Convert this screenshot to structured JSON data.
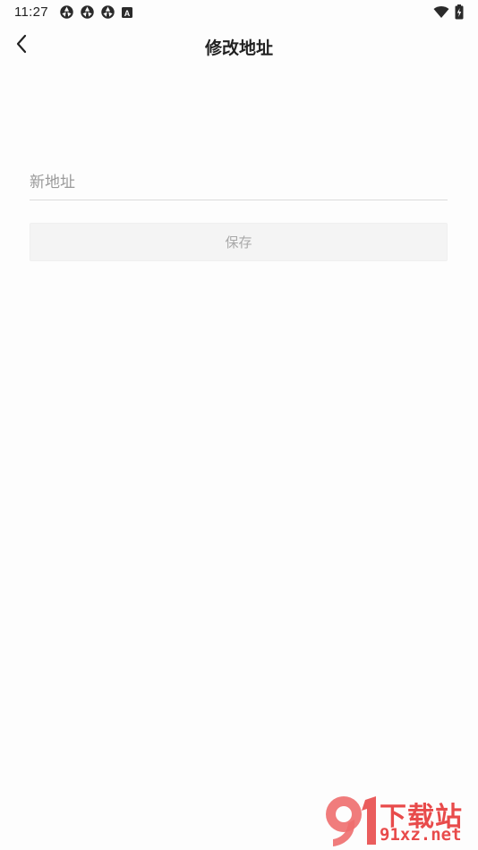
{
  "status_bar": {
    "time": "11:27",
    "notification_icons": [
      "aperture-icon",
      "aperture-icon",
      "aperture-icon",
      "a-box-icon"
    ],
    "a_box_letter": "A",
    "right_icons": [
      "wifi-icon",
      "battery-charging-icon"
    ]
  },
  "nav": {
    "back_icon": "chevron-left-icon",
    "title": "修改地址"
  },
  "form": {
    "address_value": "",
    "address_placeholder": "新地址",
    "save_label": "保存"
  },
  "watermark": {
    "logo_digits": "9",
    "top_text": "下载站",
    "bottom_text": "91xz.net"
  },
  "colors": {
    "background": "#fdfdfd",
    "title_text": "#222222",
    "placeholder_text": "#9a9a9a",
    "button_background": "#f4f4f4",
    "button_text": "#a8a8a8",
    "watermark_red": "#e84b4b"
  }
}
